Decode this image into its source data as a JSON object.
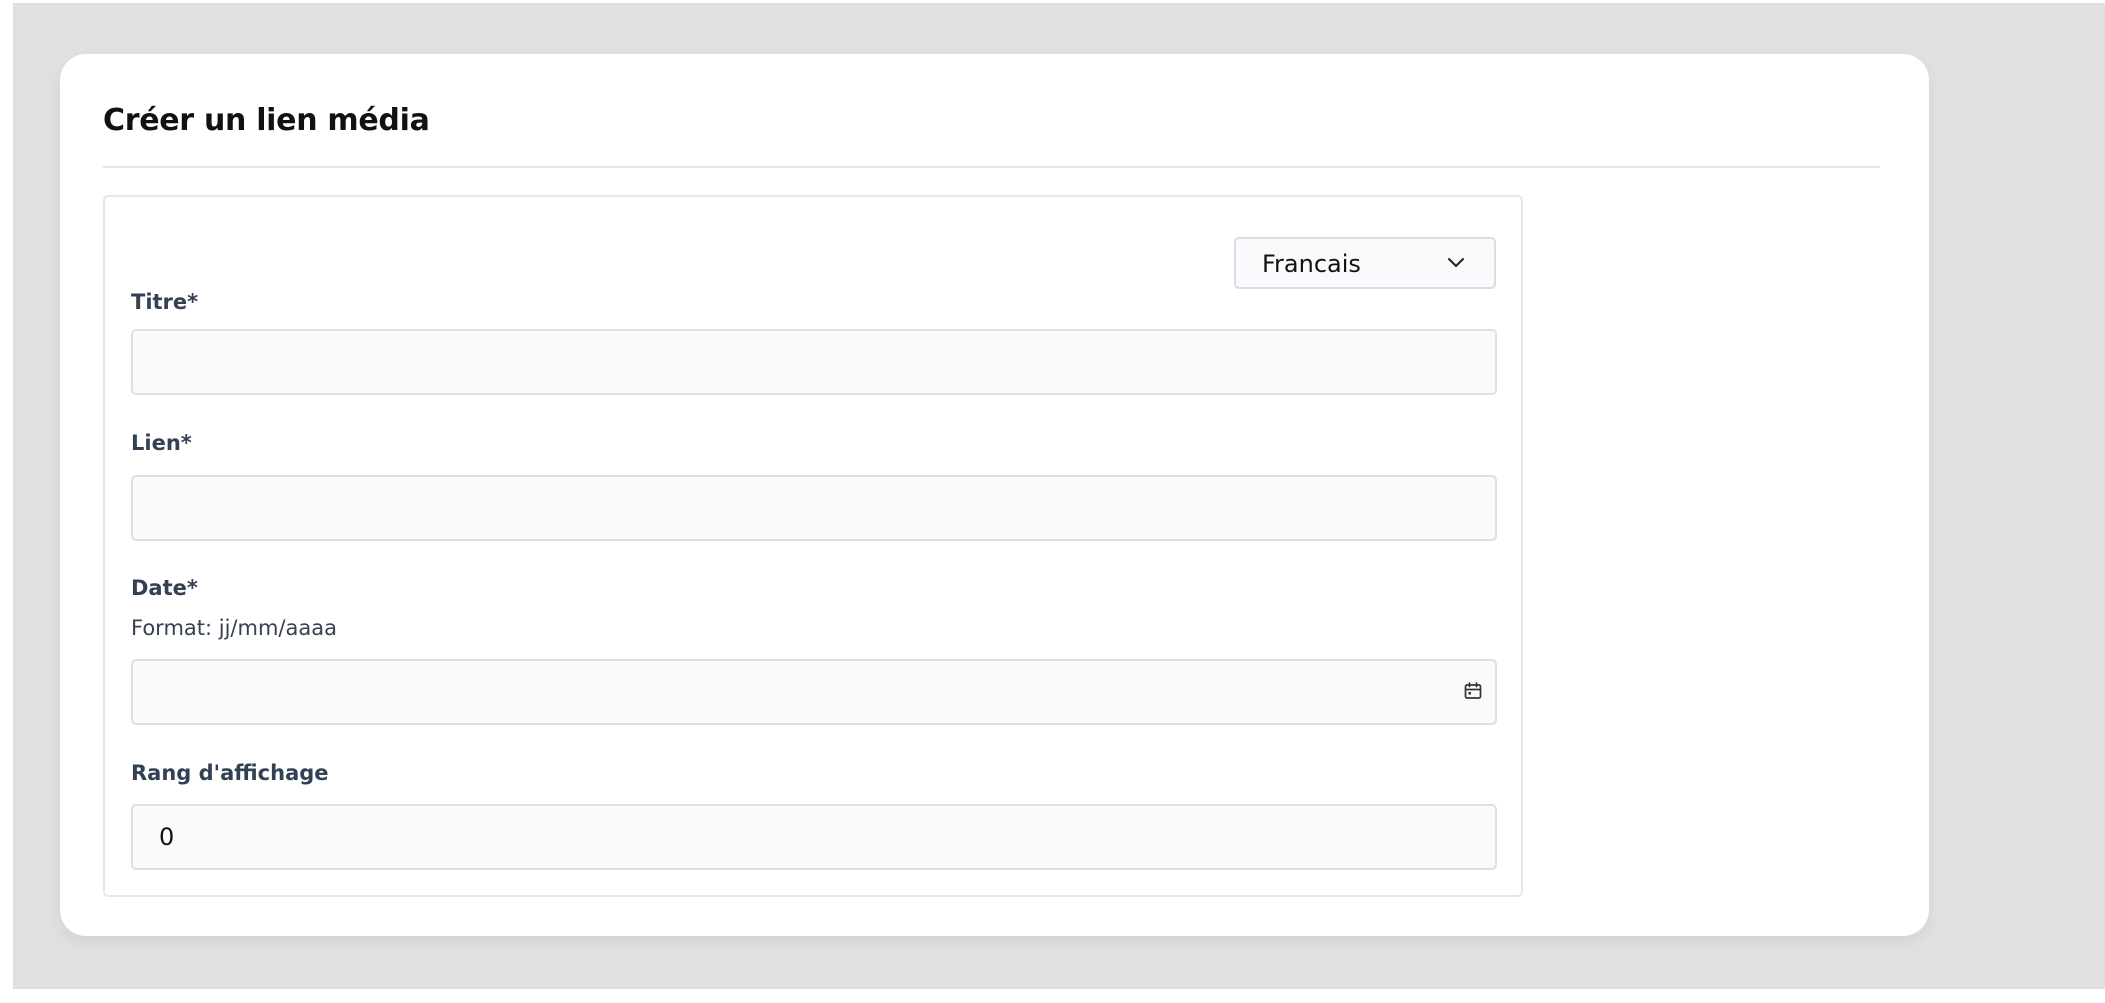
{
  "page": {
    "title": "Créer un lien média"
  },
  "language_select": {
    "selected": "Francais",
    "icon": "chevron-down-icon"
  },
  "fields": {
    "title": {
      "label": "Titre*",
      "value": ""
    },
    "link": {
      "label": "Lien*",
      "value": ""
    },
    "date": {
      "label": "Date*",
      "hint": "Format: jj/mm/aaaa",
      "value": "",
      "icon": "calendar-icon"
    },
    "display_rank": {
      "label": "Rang d'affichage",
      "value": "0"
    }
  },
  "colors": {
    "backdrop": "#e0e0e0",
    "card": "#ffffff",
    "input_background": "#f9fafb",
    "input_border": "#dde1e6",
    "label_text": "#334155",
    "title_text": "#111111"
  }
}
